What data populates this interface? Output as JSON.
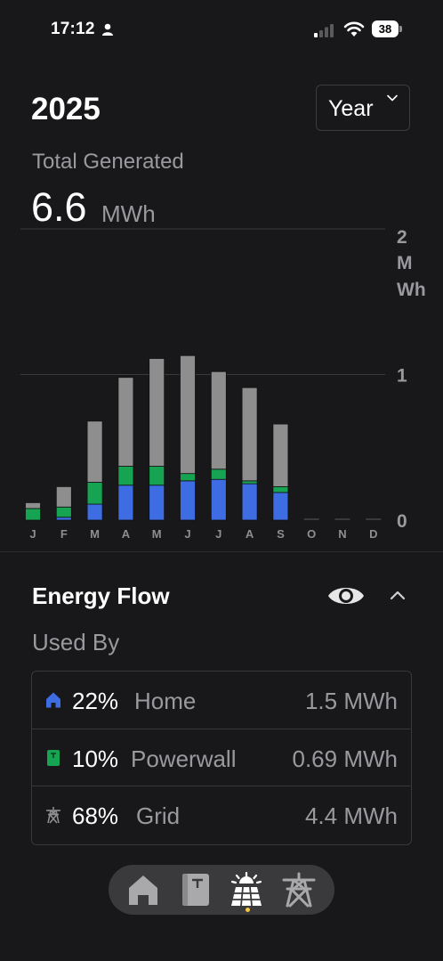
{
  "status_bar": {
    "time": "17:12",
    "battery": "38"
  },
  "header": {
    "year": "2025",
    "period_select": {
      "value": "Year"
    },
    "total_label": "Total Generated",
    "total_value": "6.6",
    "total_unit": "MWh"
  },
  "chart_data": {
    "type": "bar",
    "stacked": true,
    "categories": [
      "J",
      "F",
      "M",
      "A",
      "M",
      "J",
      "J",
      "A",
      "S",
      "O",
      "N",
      "D"
    ],
    "y_ticks": [
      "2",
      "1",
      "0"
    ],
    "y_unit_lines": [
      "M",
      "Wh"
    ],
    "ylim": [
      0,
      2
    ],
    "series": [
      {
        "color": "#3d6ce3",
        "values": [
          0.0,
          0.02,
          0.11,
          0.24,
          0.24,
          0.27,
          0.28,
          0.25,
          0.19,
          0,
          0,
          0
        ]
      },
      {
        "color": "#16a452",
        "values": [
          0.08,
          0.07,
          0.15,
          0.13,
          0.13,
          0.05,
          0.07,
          0.02,
          0.04,
          0,
          0,
          0
        ]
      },
      {
        "color": "#8e8e8e",
        "values": [
          0.04,
          0.14,
          0.42,
          0.61,
          0.74,
          0.81,
          0.67,
          0.64,
          0.43,
          0,
          0,
          0
        ]
      }
    ],
    "grid": true
  },
  "energy_flow": {
    "title": "Energy Flow",
    "used_by_label": "Used By",
    "rows": [
      {
        "icon": "house-icon",
        "percent": "22%",
        "name": "Home",
        "value": "1.5 MWh"
      },
      {
        "icon": "powerwall-icon",
        "percent": "10%",
        "name": "Powerwall",
        "value": "0.69 MWh"
      },
      {
        "icon": "grid-tower-icon",
        "percent": "68%",
        "name": "Grid",
        "value": "4.4 MWh"
      }
    ]
  },
  "dock": {
    "items": [
      "home-icon",
      "powerwall-icon",
      "solar-icon",
      "grid-tower-icon"
    ],
    "active": "solar-icon"
  },
  "colors": {
    "background": "#18181a",
    "home": "#3d6ce3",
    "powerwall": "#16a452",
    "grid": "#8e8e8e",
    "active_dot": "#f5c842"
  }
}
